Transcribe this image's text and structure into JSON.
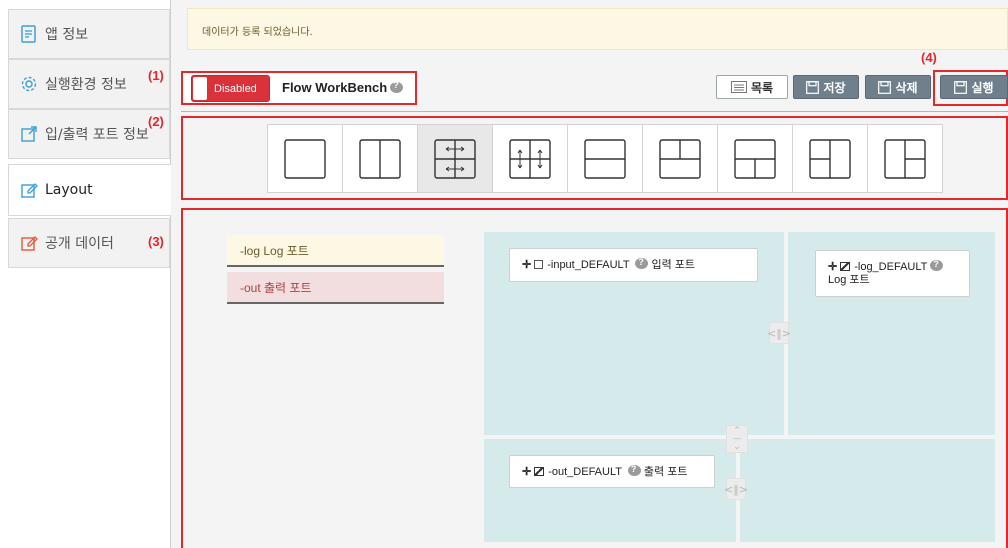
{
  "sidebar": {
    "items": [
      {
        "label": "앱 정보"
      },
      {
        "label": "실행환경 정보"
      },
      {
        "label": "입/출력 포트 정보"
      },
      {
        "label": "Layout"
      },
      {
        "label": "공개 데이터"
      }
    ]
  },
  "annotations": {
    "a1": "(1)",
    "a2": "(2)",
    "a3": "(3)",
    "a4": "(4)"
  },
  "alert": {
    "text": "데이터가 등록 되었습니다."
  },
  "toolbar": {
    "toggle_label": "Disabled",
    "title": "Flow WorkBench",
    "list_label": "목록",
    "save_label": "저장",
    "delete_label": "삭제",
    "run_label": "실행"
  },
  "layout_options": {
    "selected_index": 2,
    "names": [
      "single",
      "two-columns",
      "quad-horizontal-resize",
      "quad-vertical-resize",
      "two-rows",
      "top-split-bottom-full",
      "top-full-bottom-split",
      "left-split-right-full",
      "left-full-right-split"
    ]
  },
  "ports": {
    "log_label": "-log Log 포트",
    "out_label": "-out 출력 포트"
  },
  "canvas": {
    "card_input": "-input_DEFAULT",
    "card_input_desc": "입력 포트",
    "card_log": "-log_DEFAULT",
    "card_log_desc": "Log 포트",
    "card_out": "-out_DEFAULT",
    "card_out_desc": "출력 포트"
  },
  "colors": {
    "accent_red": "#e0282d",
    "panel": "#d5ebeb",
    "button_gray": "#6f7f8c"
  }
}
